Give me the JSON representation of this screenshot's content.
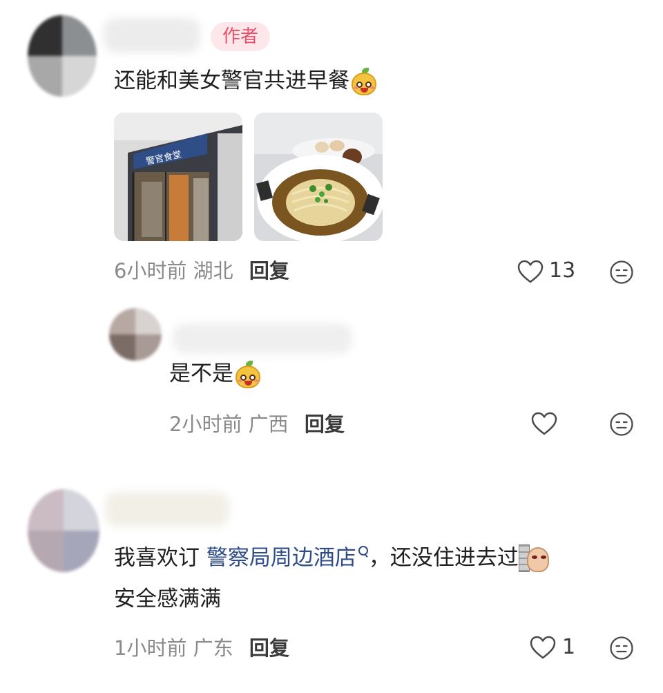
{
  "comments": [
    {
      "badge": "作者",
      "text": "还能和美女警官共进早餐",
      "time": "6小时前",
      "location": "湖北",
      "reply_label": "回复",
      "likes": "13",
      "photos": [
        "canteen-entrance-photo",
        "noodle-bowl-photo"
      ],
      "photo_sign_text": "警官食堂"
    },
    {
      "text": "是不是",
      "time": "2小时前",
      "location": "广西",
      "reply_label": "回复",
      "likes": ""
    },
    {
      "text_before": "我喜欢订",
      "link_text": "警察局周边酒店",
      "text_after": "，还没住进去过",
      "text_line2": "安全感满满",
      "time": "1小时前",
      "location": "广东",
      "reply_label": "回复",
      "likes": "1"
    }
  ],
  "icons": {
    "like": "heart-outline-icon",
    "dislike": "neutral-face-icon",
    "search": "search-icon",
    "emoji_mango": "mango-emoji",
    "emoji_wall": "wall-peek-emoji"
  },
  "colors": {
    "badge_bg": "#fde7ea",
    "badge_text": "#ee4f68",
    "link": "#2e4c8a",
    "meta": "#8a8a8a"
  }
}
